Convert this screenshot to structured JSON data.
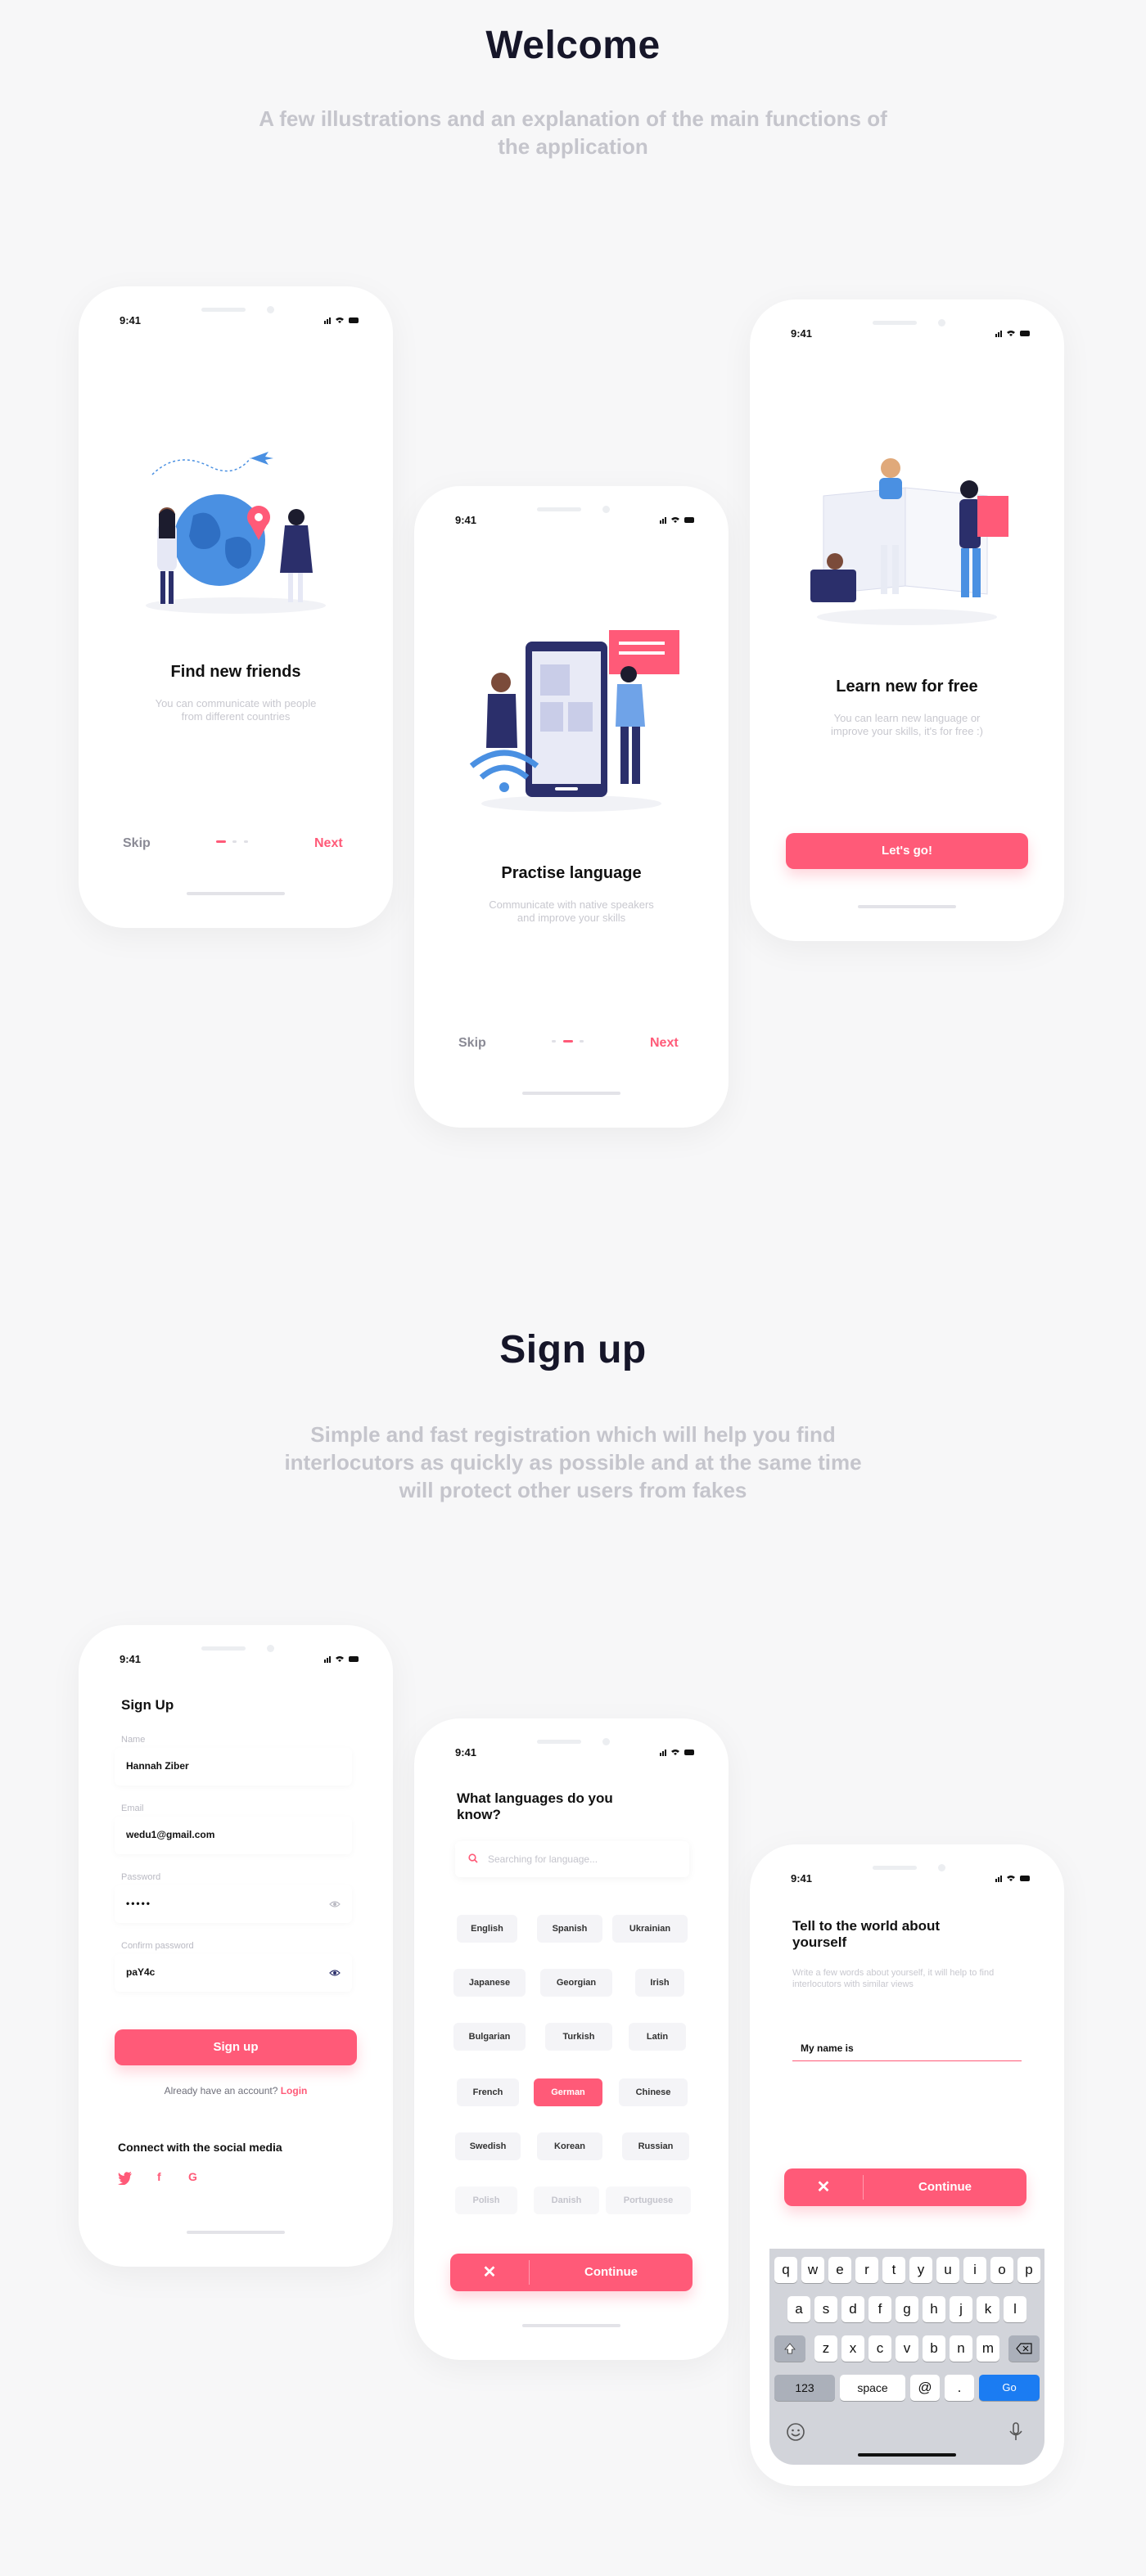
{
  "welcome": {
    "title": "Welcome",
    "subtitle": "A few illustrations and an explanation of the main functions of the application"
  },
  "signup_section": {
    "title": "Sign up",
    "subtitle": "Simple and fast registration which will help you find interlocutors as quickly as possible and at the same time will protect other users from fakes"
  },
  "status_time": "9:41",
  "onboarding": {
    "screen1": {
      "title": "Find new friends",
      "desc": "You can communicate with people from different countries",
      "skip": "Skip",
      "next": "Next"
    },
    "screen2": {
      "title": "Practise language",
      "desc": "Communicate with native speakers and improve your skills",
      "skip": "Skip",
      "next": "Next"
    },
    "screen3": {
      "title": "Learn new for free",
      "desc": "You can learn new language or improve your skills, it's for free :)",
      "button": "Let's go!"
    }
  },
  "signup_form": {
    "title": "Sign Up",
    "name_label": "Name",
    "name_value": "Hannah Ziber",
    "email_label": "Email",
    "email_value": "wedu1@gmail.com",
    "password_label": "Password",
    "password_value": "•••••",
    "confirm_label": "Confirm password",
    "confirm_value": "paY4c",
    "submit": "Sign up",
    "already": "Already have an account?",
    "login": "Login",
    "social_title": "Connect with the social media",
    "social": [
      "twitter-icon",
      "facebook-icon",
      "google-icon"
    ]
  },
  "languages": {
    "title": "What languages do you know?",
    "search_placeholder": "Searching for language...",
    "rows": [
      [
        "English",
        "Spanish",
        "Ukrainian"
      ],
      [
        "Japanese",
        "Georgian",
        "Irish"
      ],
      [
        "Bulgarian",
        "Turkish",
        "Latin"
      ],
      [
        "French",
        "German",
        "Chinese"
      ],
      [
        "Swedish",
        "Korean",
        "Russian"
      ],
      [
        "Polish",
        "Danish",
        "Portuguese"
      ]
    ],
    "selected": "German",
    "continue": "Continue",
    "close": "✕"
  },
  "about": {
    "title": "Tell to the world about yourself",
    "desc": "Write a few words about yourself, it will help to find interlocutors with similar views",
    "input_value": "My name is",
    "continue": "Continue",
    "close": "✕"
  },
  "keyboard": {
    "row1": [
      "q",
      "w",
      "e",
      "r",
      "t",
      "y",
      "u",
      "i",
      "o",
      "p"
    ],
    "row2": [
      "a",
      "s",
      "d",
      "f",
      "g",
      "h",
      "j",
      "k",
      "l"
    ],
    "row3": [
      "z",
      "x",
      "c",
      "v",
      "b",
      "n",
      "m"
    ],
    "numbers": "123",
    "space": "space",
    "at": "@",
    "dot": ".",
    "go": "Go"
  },
  "colors": {
    "accent": "#ff5a78",
    "blue": "#4a90e2",
    "navy": "#2b2f6b"
  }
}
